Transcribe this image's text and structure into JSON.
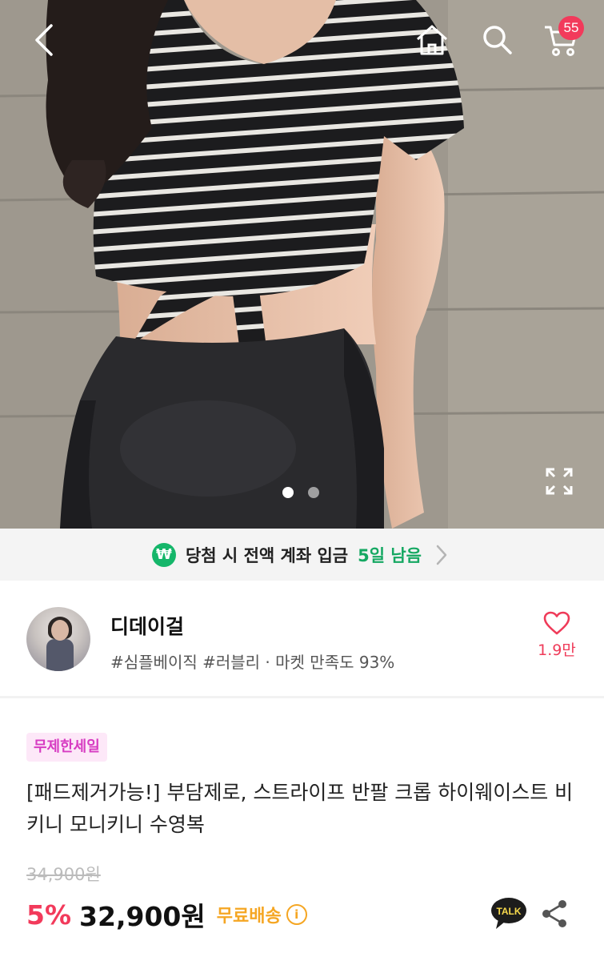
{
  "header": {
    "cart_count": "55"
  },
  "gallery": {
    "total": 2,
    "current": 1
  },
  "promo": {
    "text": "당첨 시 전액 계좌 입금",
    "days": "5일 남음",
    "icon_symbol": "₩"
  },
  "shop": {
    "name": "디데이걸",
    "tags": "#심플베이직 #러블리 · 마켓 만족도 93%",
    "likes": "1.9만"
  },
  "product": {
    "badge": "무제한세일",
    "title": "[패드제거가능!] 부담제로, 스트라이프 반팔 크롭 하이웨이스트 비키니 모니키니 수영복",
    "original_price": "34,900원",
    "discount": "5%",
    "price": "32,900원",
    "shipping": "무료배송"
  },
  "icons": {
    "kakao_label": "TALK",
    "info": "i"
  },
  "colors": {
    "accent_pink": "#f23a5b",
    "promo_green": "#15a862",
    "ship_orange": "#f5a623",
    "badge_bg": "#fde8f8",
    "badge_text": "#d73cc2"
  }
}
